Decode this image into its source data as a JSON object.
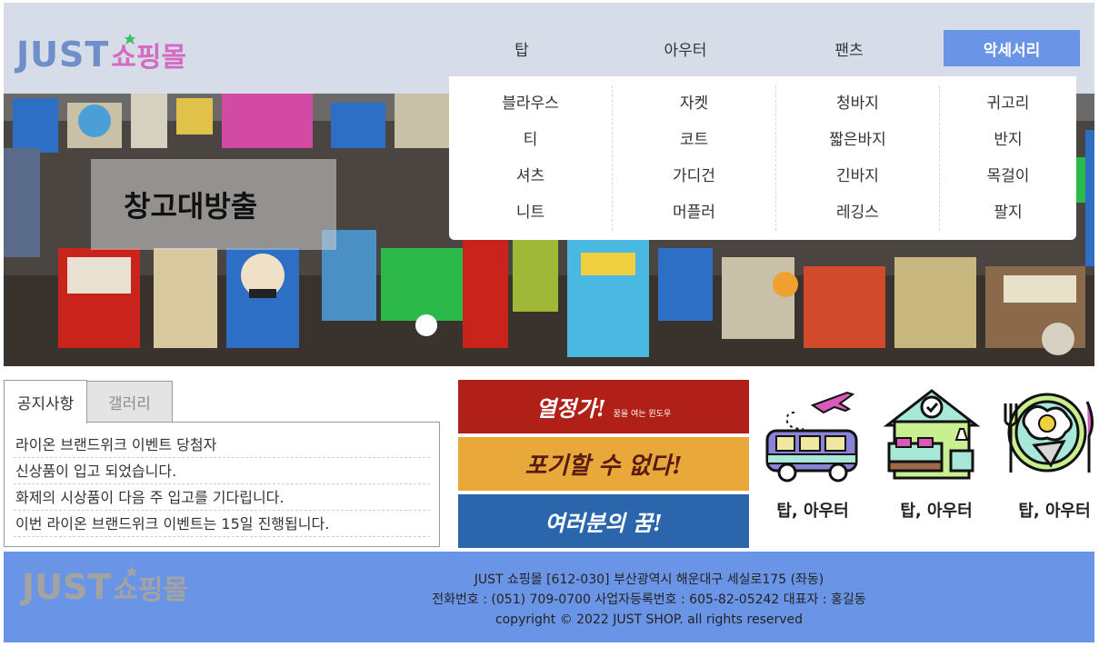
{
  "brand": {
    "just": "JUST",
    "shop": "쇼핑몰"
  },
  "colors": {
    "header_bg": "#d6dde9",
    "accent": "#6a95e6",
    "logo_just": "#6e8fc9",
    "logo_shop": "#d56ac2",
    "footer_bg": "#6a95e6",
    "footer_logo": "#a3a3a3"
  },
  "menu": {
    "items": [
      {
        "label": "탑"
      },
      {
        "label": "아우터"
      },
      {
        "label": "팬츠"
      },
      {
        "label": "악세서리",
        "active": true
      }
    ]
  },
  "submenu": {
    "columns": [
      [
        "블라우스",
        "티",
        "셔츠",
        "니트"
      ],
      [
        "자켓",
        "코트",
        "가디건",
        "머플러"
      ],
      [
        "청바지",
        "짧은바지",
        "긴바지",
        "레깅스"
      ],
      [
        "귀고리",
        "반지",
        "목걸이",
        "팔지"
      ]
    ]
  },
  "banner": {
    "caption": "창고대방출"
  },
  "notice": {
    "tabs": [
      {
        "label": "공지사항",
        "active": true
      },
      {
        "label": "갤러리",
        "active": false
      }
    ],
    "items": [
      "라이온 브랜드위크 이벤트 당첨자",
      "신상품이 입고 되었습니다.",
      "화제의 시상품이 다음 주 입고를 기다립니다.",
      "이번 라이온 브랜드위크 이벤트는 15일 진행됩니다."
    ]
  },
  "ads": [
    {
      "text": "열정가!",
      "sub": "꿈을 여는 윈도우"
    },
    {
      "text": "포기할 수 없다!"
    },
    {
      "text": "여러분의 꿈!"
    }
  ],
  "cards": [
    {
      "icon": "travel-van-icon",
      "label": "탑, 아우터"
    },
    {
      "icon": "house-bedroom-icon",
      "label": "탑, 아우터"
    },
    {
      "icon": "food-plate-icon",
      "label": "탑, 아우터"
    }
  ],
  "footer": {
    "logo_just": "JUST",
    "logo_shop": "쇼핑몰",
    "lines": [
      "JUST 쇼핑몰 [612-030] 부산광역시 해운대구 세실로175 (좌동)",
      "전화번호 : (051) 709-0700 사업자등록번호 : 605-82-05242 대표자 : 홍길동",
      "copyright © 2022 JUST SHOP. all rights reserved"
    ]
  }
}
